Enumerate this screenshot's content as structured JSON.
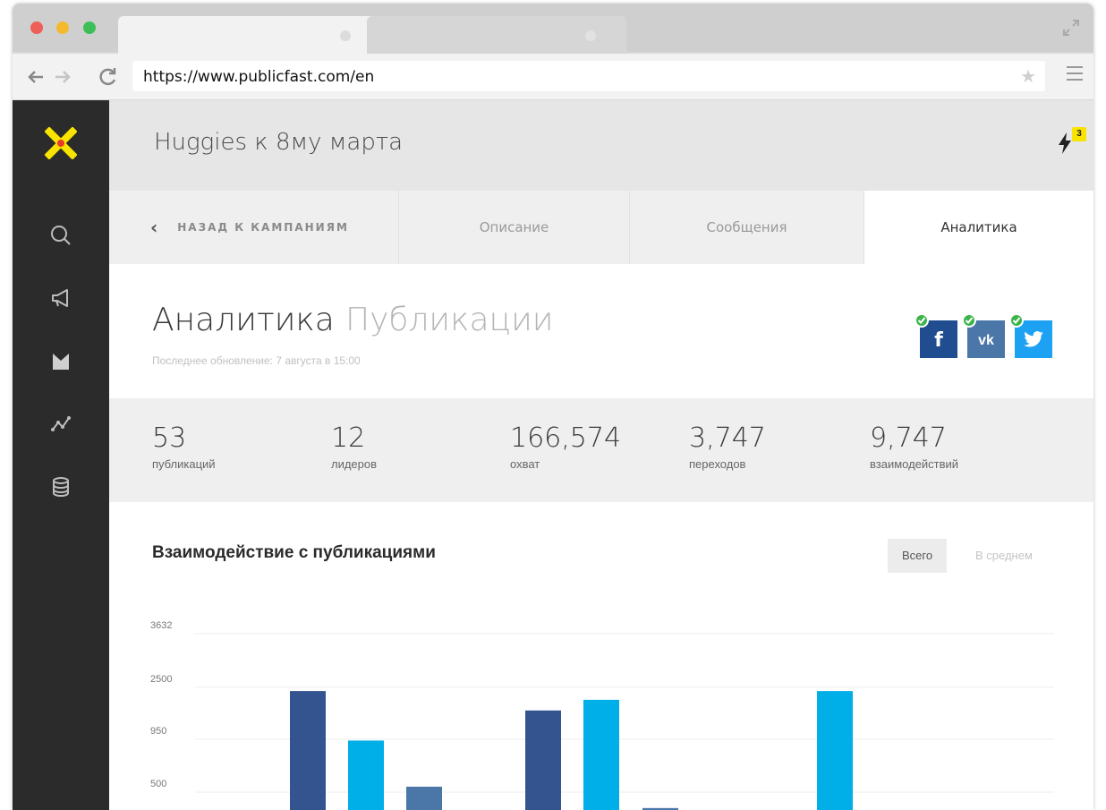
{
  "browser": {
    "url": "https://www.publicfast.com/en"
  },
  "header": {
    "title": "Huggies к 8му марта",
    "notification_count": "3"
  },
  "tabs": {
    "back": "НАЗАД К КАМПАНИЯМ",
    "description": "Описание",
    "messages": "Сообщения",
    "analytics": "Аналитика"
  },
  "page": {
    "title": "Аналитика",
    "subtitle": "Публикации",
    "last_update": "Последнее обновление: 7 августа в 15:00"
  },
  "social": {
    "facebook": "f",
    "vk": "vk",
    "twitter": "t",
    "colors": {
      "facebook": "#1f4d8f",
      "vk": "#4a76a8",
      "twitter": "#1da1f2",
      "check": "#3bb54a"
    }
  },
  "stats": [
    {
      "value": "53",
      "label": "публикаций"
    },
    {
      "value": "12",
      "label": "лидеров"
    },
    {
      "value": "166,574",
      "label": "охват"
    },
    {
      "value": "3,747",
      "label": "переходов"
    },
    {
      "value": "9,747",
      "label": "взаимодействий"
    }
  ],
  "chart_section": {
    "title": "Взаимодействие с публикациями",
    "toggle_total": "Всего",
    "toggle_average": "В среднем"
  },
  "chart_data": {
    "type": "bar",
    "title": "Взаимодействие с публикациями",
    "y_tick_labels": [
      "3632",
      "2500",
      "950",
      "500"
    ],
    "grid": true,
    "series_colors": [
      "#34548f",
      "#00aee8",
      "#4a76a8"
    ],
    "bars": [
      {
        "value": 2450,
        "color": "#34548f"
      },
      {
        "value": 1430,
        "color": "#00aee8"
      },
      {
        "value": 480,
        "color": "#4a76a8"
      },
      {
        "value": 2050,
        "color": "#34548f"
      },
      {
        "value": 2270,
        "color": "#00aee8"
      },
      {
        "value": 40,
        "color": "#4a76a8"
      },
      {
        "value": 2450,
        "color": "#00aee8"
      }
    ]
  }
}
